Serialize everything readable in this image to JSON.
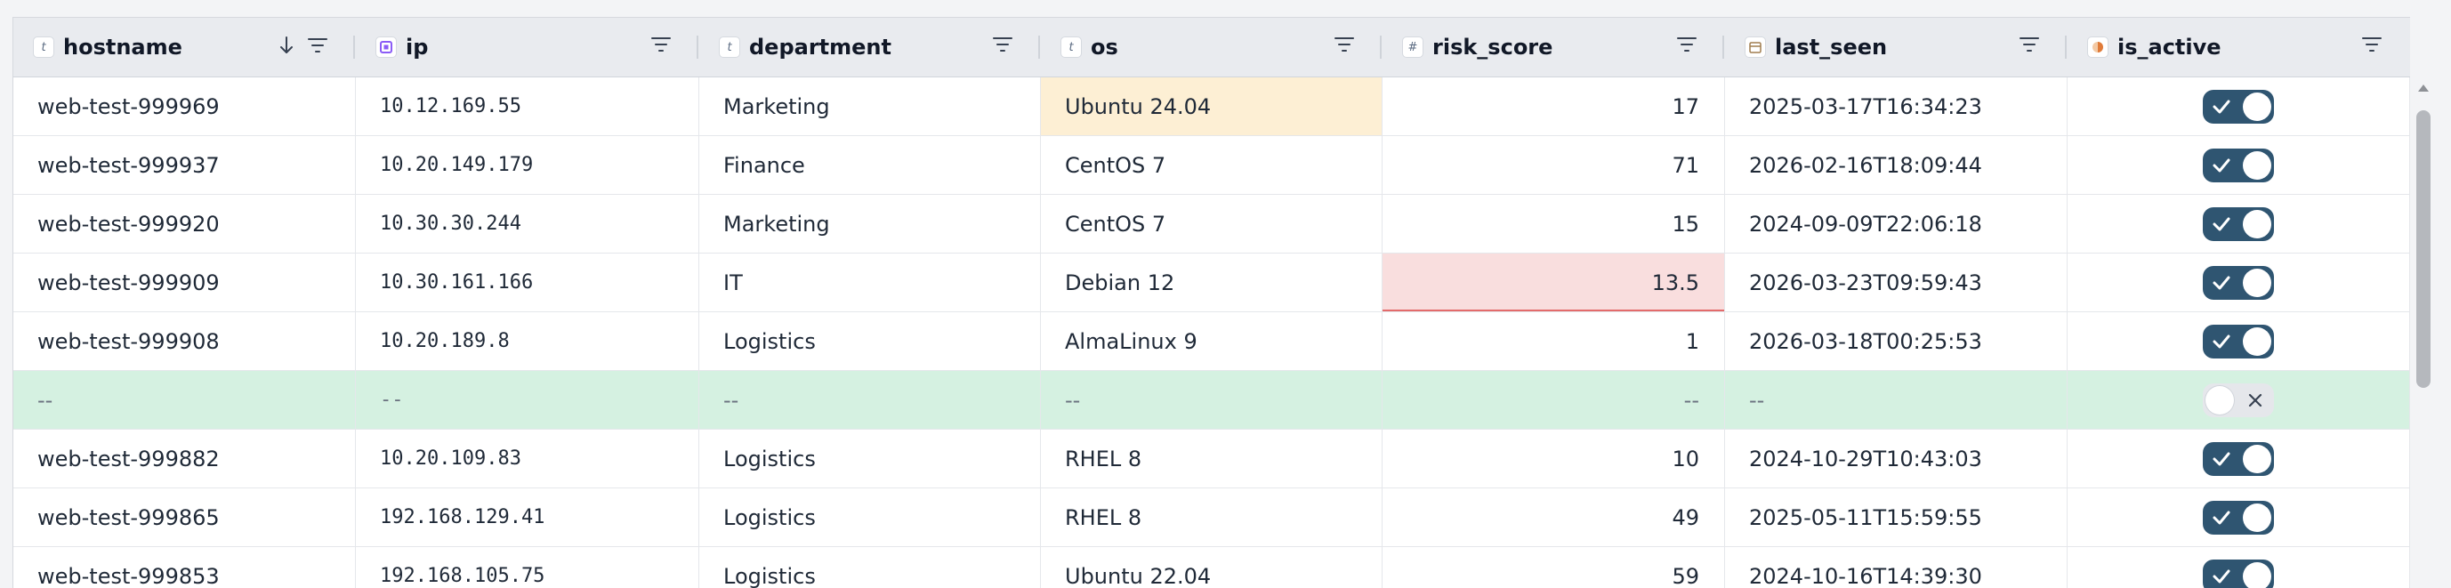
{
  "columns": [
    {
      "key": "hostname",
      "label": "hostname",
      "type_glyph": "t",
      "type_color": "#5b6b82",
      "sorted": "desc"
    },
    {
      "key": "ip",
      "label": "ip",
      "type_glyph": "ip",
      "type_color": "#8b5cf6"
    },
    {
      "key": "department",
      "label": "department",
      "type_glyph": "t",
      "type_color": "#5b6b82"
    },
    {
      "key": "os",
      "label": "os",
      "type_glyph": "t",
      "type_color": "#5b6b82"
    },
    {
      "key": "risk_score",
      "label": "risk_score",
      "type_glyph": "#",
      "type_color": "#5b6b82"
    },
    {
      "key": "last_seen",
      "label": "last_seen",
      "type_glyph": "calendar",
      "type_color": "#a07d4f"
    },
    {
      "key": "is_active",
      "label": "is_active",
      "type_glyph": "toggle",
      "type_color": "#e07b39"
    }
  ],
  "rows": [
    {
      "hostname": "web-test-999969",
      "ip": "10.12.169.55",
      "department": "Marketing",
      "os": "Ubuntu 24.04",
      "risk_score": "17",
      "last_seen": "2025-03-17T16:34:23",
      "is_active": true,
      "highlight": "os"
    },
    {
      "hostname": "web-test-999937",
      "ip": "10.20.149.179",
      "department": "Finance",
      "os": "CentOS 7",
      "risk_score": "71",
      "last_seen": "2026-02-16T18:09:44",
      "is_active": true
    },
    {
      "hostname": "web-test-999920",
      "ip": "10.30.30.244",
      "department": "Marketing",
      "os": "CentOS 7",
      "risk_score": "15",
      "last_seen": "2024-09-09T22:06:18",
      "is_active": true
    },
    {
      "hostname": "web-test-999909",
      "ip": "10.30.161.166",
      "department": "IT",
      "os": "Debian 12",
      "risk_score": "13.5",
      "last_seen": "2026-03-23T09:59:43",
      "is_active": true,
      "error": "risk_score"
    },
    {
      "hostname": "web-test-999908",
      "ip": "10.20.189.8",
      "department": "Logistics",
      "os": "AlmaLinux 9",
      "risk_score": "1",
      "last_seen": "2026-03-18T00:25:53",
      "is_active": true
    },
    {
      "hostname": "--",
      "ip": "--",
      "department": "--",
      "os": "--",
      "risk_score": "--",
      "last_seen": "--",
      "is_active": false,
      "blank": true
    },
    {
      "hostname": "web-test-999882",
      "ip": "10.20.109.83",
      "department": "Logistics",
      "os": "RHEL 8",
      "risk_score": "10",
      "last_seen": "2024-10-29T10:43:03",
      "is_active": true
    },
    {
      "hostname": "web-test-999865",
      "ip": "192.168.129.41",
      "department": "Logistics",
      "os": "RHEL 8",
      "risk_score": "49",
      "last_seen": "2025-05-11T15:59:55",
      "is_active": true
    },
    {
      "hostname": "web-test-999853",
      "ip": "192.168.105.75",
      "department": "Logistics",
      "os": "Ubuntu 22.04",
      "risk_score": "59",
      "last_seen": "2024-10-16T14:39:30",
      "is_active": true
    }
  ],
  "colors": {
    "toggle_on": "#2f5571",
    "blank_row": "#d5f1e1",
    "highlight_cell": "#fdefd4",
    "error_cell": "#f9dede"
  }
}
